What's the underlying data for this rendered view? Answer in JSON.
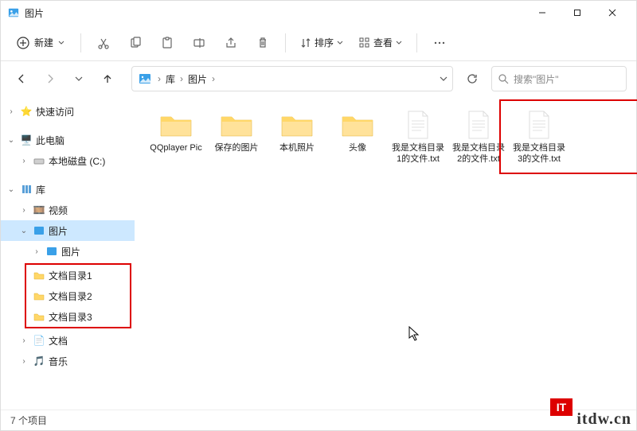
{
  "window": {
    "title": "图片",
    "min": "–",
    "max": "❐",
    "close": "✕"
  },
  "toolbar": {
    "new_label": "新建",
    "sort_label": "排序",
    "view_label": "查看"
  },
  "nav": {
    "crumb1": "库",
    "crumb2": "图片",
    "search_placeholder": "搜索\"图片\""
  },
  "sidebar": {
    "quick": "快速访问",
    "thispc": "此电脑",
    "cdrive": "本地磁盘 (C:)",
    "libraries": "库",
    "video": "视频",
    "pictures": "图片",
    "pictures_sub": "图片",
    "docdir1": "文档目录1",
    "docdir2": "文档目录2",
    "docdir3": "文档目录3",
    "documents": "文档",
    "music": "音乐"
  },
  "items": [
    {
      "type": "folder",
      "label": "QQplayer\nPic"
    },
    {
      "type": "folder",
      "label": "保存的图片"
    },
    {
      "type": "folder",
      "label": "本机照片"
    },
    {
      "type": "folder",
      "label": "头像"
    },
    {
      "type": "file",
      "label": "我是文档目录1的文件.txt"
    },
    {
      "type": "file",
      "label": "我是文档目录2的文件.txt"
    },
    {
      "type": "file",
      "label": "我是文档目录3的文件.txt"
    }
  ],
  "status": {
    "count": "7 个项目"
  },
  "watermark": {
    "badge": "IT",
    "text": "itdw.cn"
  }
}
